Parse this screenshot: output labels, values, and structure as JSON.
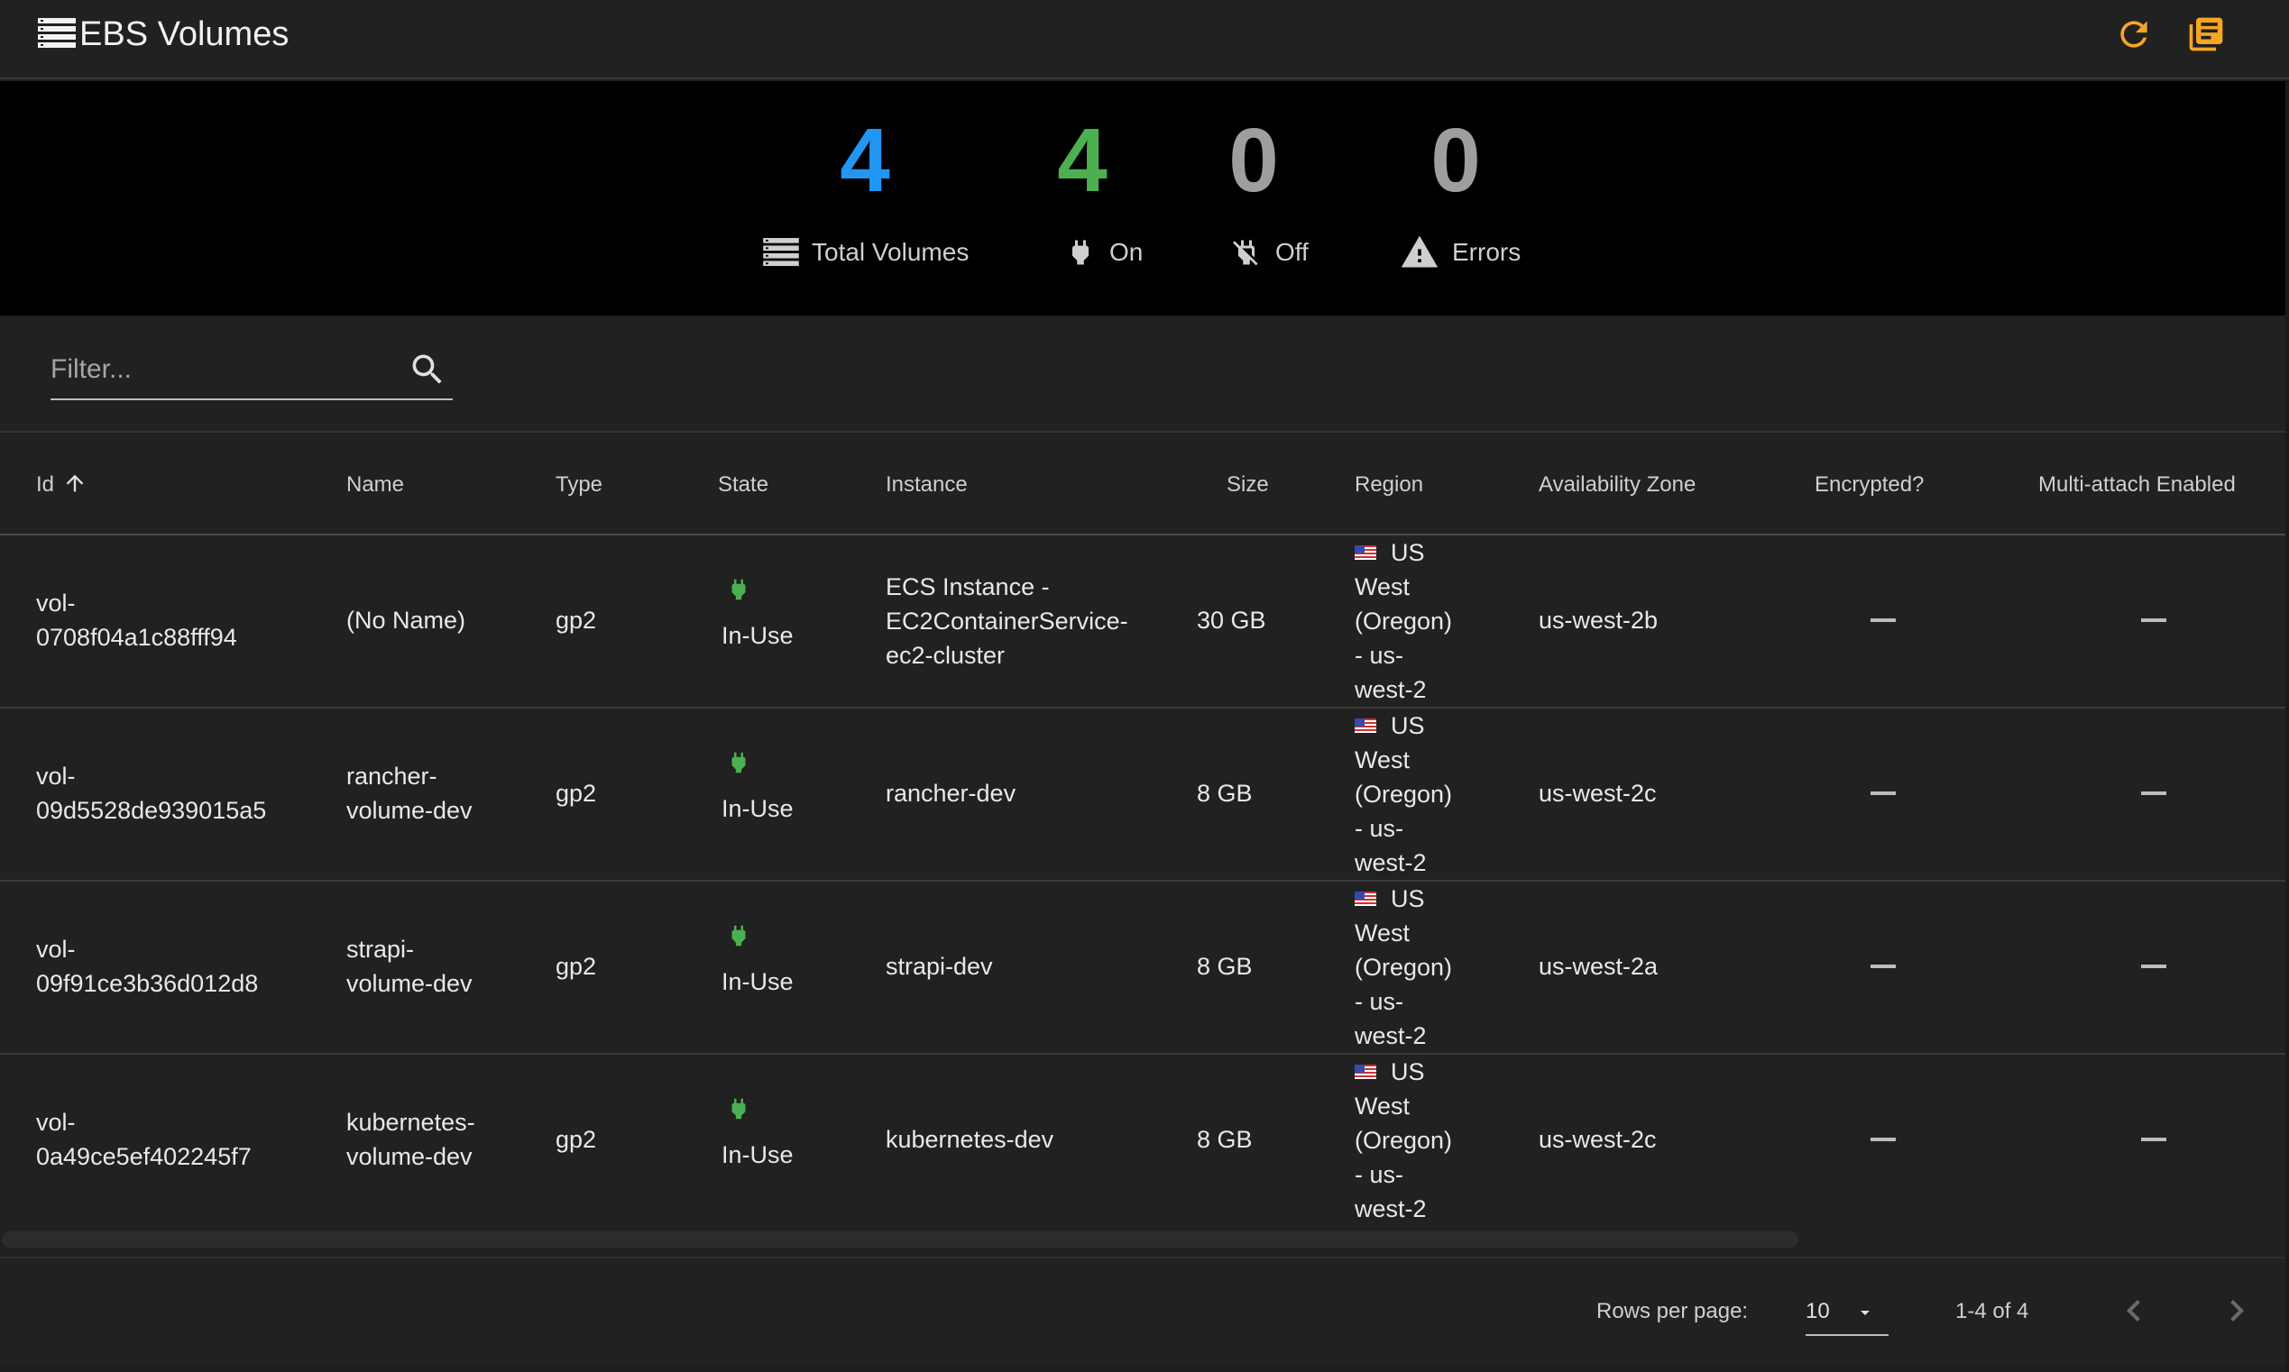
{
  "header": {
    "title": "EBS Volumes",
    "icons": {
      "list": "list-storage-icon",
      "refresh": "refresh-icon",
      "docs": "library-books-icon"
    },
    "accent": "#f5a623"
  },
  "stats": [
    {
      "value": "4",
      "label": "Total Volumes",
      "icon": "storage-icon",
      "color": "#2196f3"
    },
    {
      "value": "4",
      "label": "On",
      "icon": "power-plug-icon",
      "color": "#4caf50"
    },
    {
      "value": "0",
      "label": "Off",
      "icon": "power-plug-off-icon",
      "color": "#9e9e9e"
    },
    {
      "value": "0",
      "label": "Errors",
      "icon": "warning-icon",
      "color": "#9e9e9e"
    }
  ],
  "filter": {
    "placeholder": "Filter...",
    "value": ""
  },
  "table": {
    "columns": [
      "Id",
      "Name",
      "Type",
      "State",
      "Instance",
      "Size",
      "Region",
      "Availability Zone",
      "Encrypted?",
      "Multi-attach Enabled"
    ],
    "sort": {
      "column": "Id",
      "direction": "ascending",
      "icon": "arrow-up-icon"
    },
    "rows": [
      {
        "id": [
          "vol-",
          "0708f04a1c88fff94"
        ],
        "name": [
          "(No Name)"
        ],
        "type": "gp2",
        "state": "In-Use",
        "instance": [
          "ECS Instance -",
          "EC2ContainerService-",
          "ec2-cluster"
        ],
        "size": "30 GB",
        "region": [
          "US",
          "West",
          "(Oregon)",
          "- us-",
          "west-2"
        ],
        "az": "us-west-2b",
        "encrypted": "—",
        "multi_attach": "—"
      },
      {
        "id": [
          "vol-",
          "09d5528de939015a5"
        ],
        "name": [
          "rancher-",
          "volume-dev"
        ],
        "type": "gp2",
        "state": "In-Use",
        "instance": [
          "rancher-dev"
        ],
        "size": "8 GB",
        "region": [
          "US",
          "West",
          "(Oregon)",
          "- us-",
          "west-2"
        ],
        "az": "us-west-2c",
        "encrypted": "—",
        "multi_attach": "—"
      },
      {
        "id": [
          "vol-",
          "09f91ce3b36d012d8"
        ],
        "name": [
          "strapi-",
          "volume-dev"
        ],
        "type": "gp2",
        "state": "In-Use",
        "instance": [
          "strapi-dev"
        ],
        "size": "8 GB",
        "region": [
          "US",
          "West",
          "(Oregon)",
          "- us-",
          "west-2"
        ],
        "az": "us-west-2a",
        "encrypted": "—",
        "multi_attach": "—"
      },
      {
        "id": [
          "vol-",
          "0a49ce5ef402245f7"
        ],
        "name": [
          "kubernetes-",
          "volume-dev"
        ],
        "type": "gp2",
        "state": "In-Use",
        "instance": [
          "kubernetes-dev"
        ],
        "size": "8 GB",
        "region": [
          "US",
          "West",
          "(Oregon)",
          "- us-",
          "west-2"
        ],
        "az": "us-west-2c",
        "encrypted": "—",
        "multi_attach": "—"
      }
    ],
    "state_color": "#4caf50"
  },
  "pagination": {
    "rows_per_page_label": "Rows per page:",
    "rows_per_page": "10",
    "range": "1-4 of 4"
  }
}
